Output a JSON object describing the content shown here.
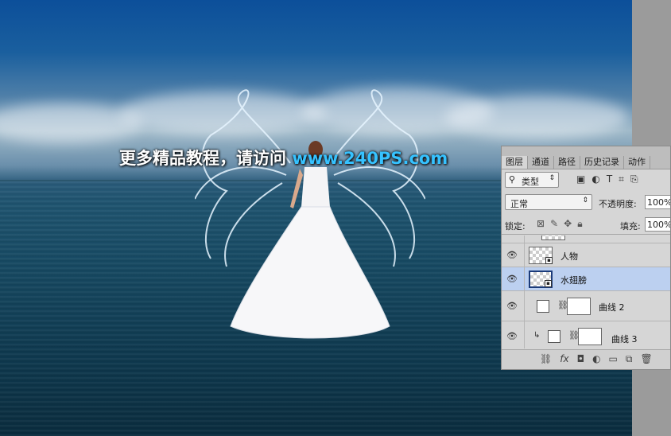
{
  "watermark": {
    "text": "更多精品教程，请访问 ",
    "url": "www.240PS.com"
  },
  "panel": {
    "tabs": [
      "图层",
      "通道",
      "路径",
      "历史记录",
      "动作"
    ],
    "active_tab": "图层",
    "filter": {
      "label": "类型",
      "icon": "search-icon",
      "arrow": "⇕"
    },
    "filter_icons": [
      "image-filter-icon",
      "adjustment-filter-icon",
      "type-filter-icon",
      "shape-filter-icon",
      "smart-object-filter-icon"
    ],
    "blend_mode": "正常",
    "opacity_label": "不透明度:",
    "opacity_value": "100%",
    "lock_label": "锁定:",
    "fill_label": "填充:",
    "fill_value": "100%",
    "layers": [
      {
        "name": "",
        "visible": false,
        "kind": "partial"
      },
      {
        "name": "人物",
        "visible": true,
        "kind": "smart"
      },
      {
        "name": "水翅膀",
        "visible": true,
        "kind": "smart",
        "selected": true
      },
      {
        "name": "曲线 2",
        "visible": true,
        "kind": "curves"
      },
      {
        "name": "曲线 3",
        "visible": true,
        "kind": "curves",
        "clipped": true
      }
    ],
    "bottom_icons": [
      "link-layers-icon",
      "fx-icon",
      "add-mask-icon",
      "new-adjustment-icon",
      "new-group-icon",
      "new-layer-icon",
      "delete-icon"
    ]
  },
  "colors": {
    "selected_layer": "#bcd0f0",
    "panel_bg": "#d6d6d6",
    "url_color": "#36c2ff"
  }
}
